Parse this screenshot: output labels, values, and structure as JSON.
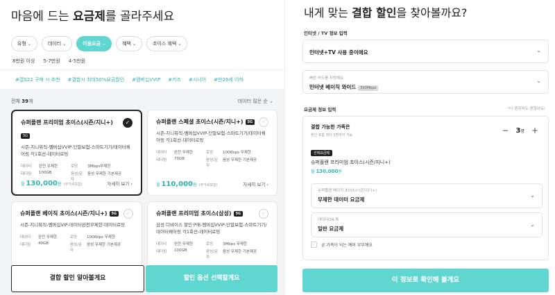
{
  "left": {
    "title_prefix": "마음에 드는 ",
    "title_bold": "요금제",
    "title_suffix": "를 골라주세요",
    "filters": [
      {
        "label": "유형",
        "active": false
      },
      {
        "label": "데이터",
        "active": false
      },
      {
        "label": "이용요금",
        "active": true
      },
      {
        "label": "혜택",
        "active": false
      },
      {
        "label": "초이스 혜택",
        "active": false
      }
    ],
    "price_ranges": [
      "8만원 이상",
      "5-7만원",
      "4-5만원"
    ],
    "tags": [
      "#갤S22 구매 시 추천",
      "#결합시 최대50%요금할인",
      "#멤버십VVIP",
      "#키즈",
      "#시니어",
      "#만29세 이하"
    ],
    "count_prefix": "전체 ",
    "count_value": "39",
    "count_suffix": "개",
    "sort_label": "데이터 많은 순",
    "sort_chevron": "⌄",
    "cards": [
      {
        "name": "슈퍼플랜 프리미엄 초이스(시즌/지니+)",
        "badge": "5G",
        "selected": true,
        "desc": "시즌-지니뮤직-멤버십VVIP-단말보험-스마트기기/데이터쉐어링 각1회선-데이터로밍",
        "meta": [
          {
            "k": "데이터",
            "v": "완전 무제한",
            "k2": "로밍",
            "v2": "3Mbps무제한"
          },
          {
            "k": "테더링",
            "v": "100GB",
            "k2": "음성/문자",
            "v2": "음성 무제한 기본제공"
          }
        ],
        "price_prefix": "월 ",
        "price": "130,000",
        "price_unit": "원",
        "price_note": "(부가세포함)",
        "more": "자세히 보기 ›"
      },
      {
        "name": "슈퍼플랜 스페셜 초이스(시즌/지니+)",
        "badge": "5G",
        "selected": false,
        "desc": "시즌-지니뮤직-멤버십VVIP-단말보험-스마트기기/데이터쉐어링 각1회선-데이터로밍",
        "meta": [
          {
            "k": "데이터",
            "v": "완전 무제한",
            "k2": "로밍",
            "v2": "100Kbps 무제한"
          },
          {
            "k": "테더링",
            "v": "70GB",
            "k2": "음성/문자",
            "v2": "음성 무제한 기본제공"
          }
        ],
        "price_prefix": "월 ",
        "price": "110,000",
        "price_unit": "원",
        "price_note": "(부가세포함)",
        "more": "자세히 보기 ›"
      },
      {
        "name": "슈퍼플랜 베이직 초이스(시즌/지니+)",
        "badge": "5G",
        "selected": false,
        "desc": "시즌-지니뮤직-멤버십VIP-데이터완전무제한-데이터로밍",
        "meta": [
          {
            "k": "데이터",
            "v": "완전 무제한",
            "k2": "로밍",
            "v2": "100Kbps 무제한"
          },
          {
            "k": "테더링",
            "v": "40GB",
            "k2": "음성/문자",
            "v2": "음성 무제한 기본제공"
          }
        ]
      },
      {
        "name": "슈퍼플랜 프리미엄 초이스(삼성)",
        "badge": "5G",
        "selected": false,
        "desc": "삼성 디바이스 할인구매-멤버십VVIP-단말보험-스마트기기/데이터쉐어링 각1회선-데이터로밍",
        "meta": [
          {
            "k": "데이터",
            "v": "완전 무제한",
            "k2": "로밍",
            "v2": "3Mbps 무제한"
          },
          {
            "k": "테더링",
            "v": "100GB",
            "k2": "음성/문자",
            "v2": "음성 무제한 기본제공"
          }
        ]
      }
    ],
    "btn_discount": "결합 할인 알아볼게요",
    "btn_options": "할인 옵션 선택할게요"
  },
  "right": {
    "title_prefix": "내게 맞는 ",
    "title_bold": "결합 할인",
    "title_suffix": "을 찾아볼까요?",
    "internet_section_label": "인터넷 / TV 정보 입력",
    "internet_select_value": "인터넷+TV 사용 중이에요",
    "speed_sub_label": "빠른 속도를 자랑해요",
    "speed_value": "인터넷 베이직 와이드",
    "speed_tag": "500Mbps",
    "plan_section_label": "요금제 정보 입력",
    "note": "*나 혼자라도 괜찮아요!",
    "combo_title": "결합 가능한 가족은",
    "combo_sub": "본인 포함 최대 5명까지 가능",
    "stepper_minus": "−",
    "stepper_value": "3",
    "stepper_unit": "명",
    "stepper_plus": "+",
    "selected_badge": "선택요금제",
    "selected_plan": "슈퍼플랜 프리미엄 초이스(시즌/지니+)",
    "selected_price_prefix": "월 ",
    "selected_price": "130,000",
    "selected_price_unit": "원",
    "sub1_label": "슈퍼플랜 베이직 초이스(시즌/지니+)",
    "sub1_value": "무제한 데이터 요금제",
    "sub2_label": "데이터ON 톡",
    "sub2_value": "일반 요금제",
    "checkbox_label": "곧 가족이 되는 예비 부부예요",
    "confirm": "이 정보로 확인해 볼게요"
  },
  "colors": {
    "accent": "#5fd6d0",
    "accent_text": "#2fb5ae",
    "dark": "#222222"
  }
}
